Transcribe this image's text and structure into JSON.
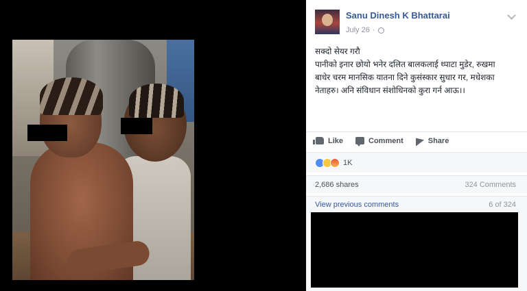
{
  "post": {
    "author": "Sanu Dinesh K Bhattarai",
    "date": "July 26",
    "privacy_icon": "globe-icon",
    "menu_icon": "chevron-down-icon",
    "text_lines": [
      "सक्दो सेयर गरौ",
      "पानीको इनार छोयो भनेर दलित बालकलाई थ्पाटा मुडेर, रुखमा",
      "बाधेर चरम मानसिक यातना दिने कुसंस्कार सुधार गर, मधेशका",
      "नेताहरु। अनि संविधान संशोधिनको कुरा गर्न आऊ।।"
    ]
  },
  "actions": {
    "like": "Like",
    "comment": "Comment",
    "share": "Share"
  },
  "reactions": {
    "count": "1K",
    "types": [
      "like",
      "sad",
      "angry"
    ]
  },
  "stats": {
    "shares": "2,686 shares",
    "comments": "324 Comments"
  },
  "comments_nav": {
    "view_previous": "View previous comments",
    "position": "6 of 324"
  }
}
